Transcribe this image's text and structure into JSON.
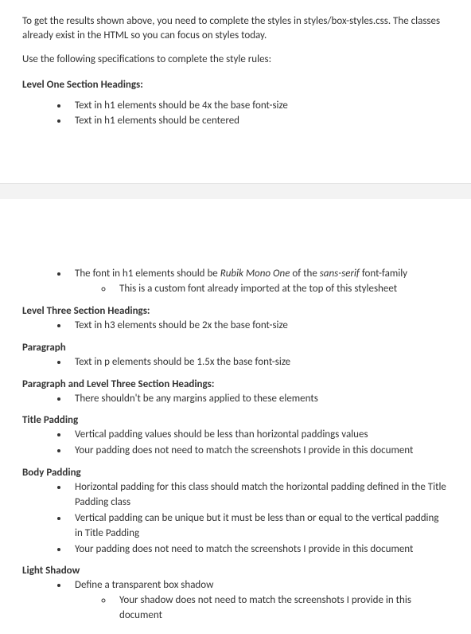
{
  "top": {
    "intro": "To get the results shown above, you need to complete the styles in styles/box-styles.css.  The classes already exist in the HTML so you can focus on styles today.",
    "subintro": "Use the following specifications to complete the style rules:",
    "h1_heading": "Level One Section Headings:",
    "h1_bullets": [
      "Text in h1 elements should be 4x the base font-size",
      "Text in h1 elements should be centered"
    ]
  },
  "bottom": {
    "font_bullet_pre": "The font in h1 elements should be ",
    "font_bullet_em": "Rubik Mono One",
    "font_bullet_mid": " of the ",
    "font_bullet_em2": "sans-serif",
    "font_bullet_post": " font-family",
    "font_sub": "This is a custom font already imported at the top of this stylesheet",
    "h3_heading": "Level Three Section Headings:",
    "h3_bullets": [
      "Text in h3 elements should be 2x the base font-size"
    ],
    "p_heading": "Paragraph",
    "p_bullets": [
      "Text in p elements should be 1.5x the base font-size"
    ],
    "ph3_heading": "Paragraph and Level Three Section Headings:",
    "ph3_bullets": [
      "There shouldn't be any margins applied to these elements"
    ],
    "title_pad_heading": "Title Padding",
    "title_pad_bullets": [
      "Vertical padding values should be less than horizontal paddings values",
      "Your padding does not need to match the screenshots I provide in this document"
    ],
    "body_pad_heading": "Body Padding",
    "body_pad_bullets": [
      "Horizontal padding for this class should match the horizontal padding defined in the Title Padding class",
      "Vertical padding can be unique but it must be less than or equal to the vertical padding in Title Padding",
      "Your padding does not need to match the screenshots I provide in this document"
    ],
    "shadow_heading": "Light Shadow",
    "shadow_bullets": [
      "Define a transparent box shadow"
    ],
    "shadow_sub": "Your shadow does not need to match the screenshots I provide in this document"
  }
}
